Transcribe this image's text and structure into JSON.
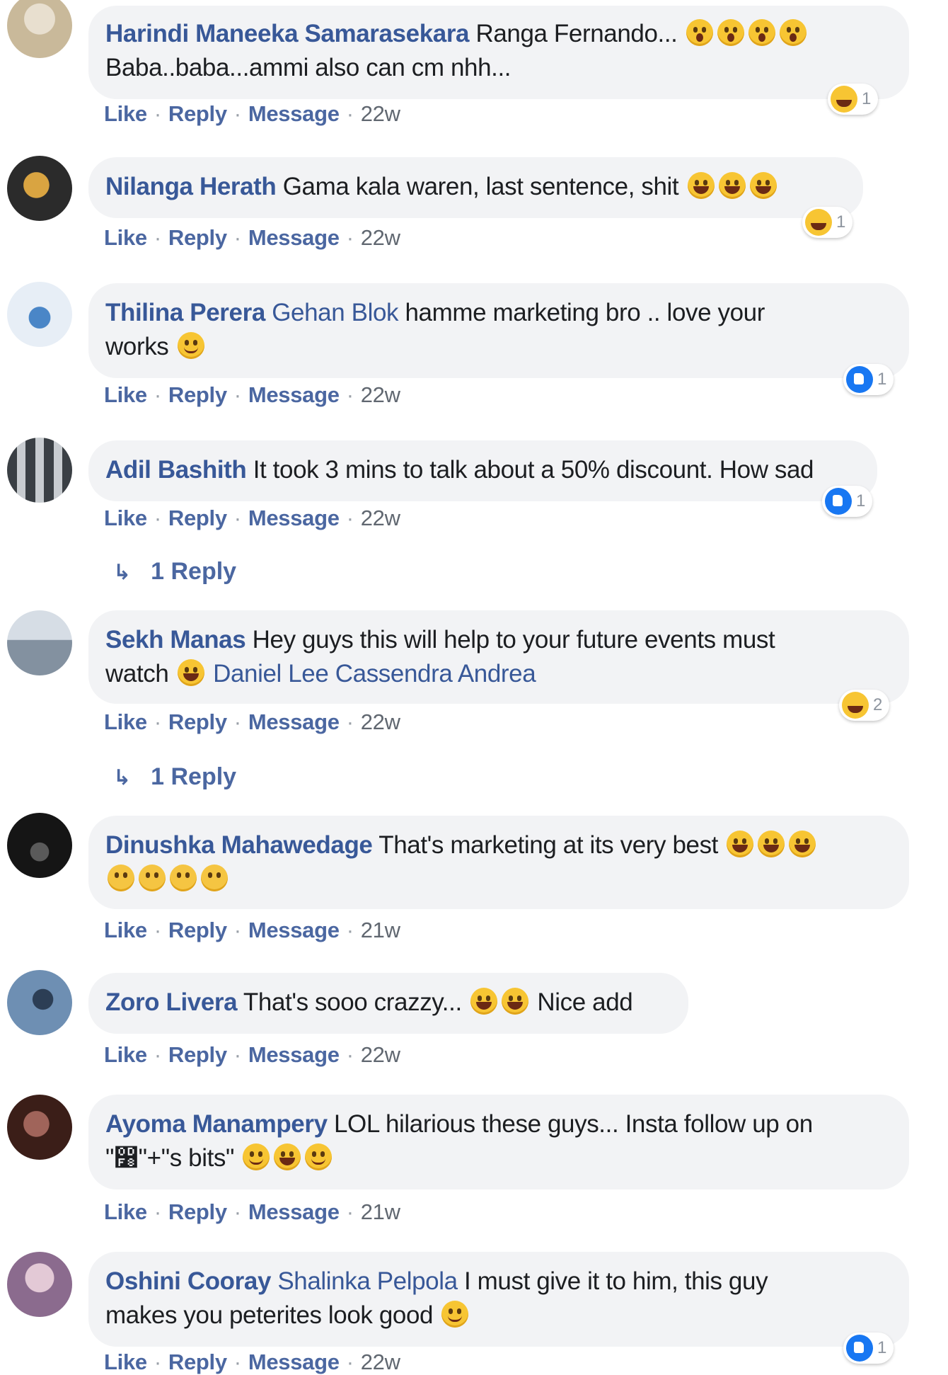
{
  "actions": {
    "like": "Like",
    "reply": "Reply",
    "message": "Message"
  },
  "comments": [
    {
      "author": "Harindi Maneeka Samarasekara",
      "tag": "",
      "text": "Ranga Fernando...",
      "line2": "Baba..baba...ammi also can cm nhh...",
      "time": "22w",
      "reaction": {
        "type": "haha",
        "count": "1"
      },
      "avatar_colors": [
        "#c9b99a",
        "#e8dfcf"
      ]
    },
    {
      "author": "Nilanga Herath",
      "text": "Gama kala waren, last sentence, shit",
      "time": "22w",
      "reaction": {
        "type": "haha",
        "count": "1"
      },
      "avatar_colors": [
        "#2b2b2b",
        "#d9a441"
      ]
    },
    {
      "author": "Thilina Perera",
      "tag": "Gehan Blok",
      "text": "hamme marketing bro .. love your",
      "line2": "works",
      "time": "22w",
      "reaction": {
        "type": "like",
        "count": "1"
      },
      "avatar_colors": [
        "#e7eef6",
        "#4a86c7"
      ]
    },
    {
      "author": "Adil Bashith",
      "text": "It took 3 mins to talk about a 50% discount. How sad",
      "time": "22w",
      "reaction": {
        "type": "like",
        "count": "1"
      },
      "replies": "1 Reply",
      "avatar_colors": [
        "#3a3f44",
        "#c8ccd0"
      ]
    },
    {
      "author": "Sekh Manas",
      "text": "Hey guys this will help to your future events must",
      "line2_pre": "watch",
      "tag2": "Daniel Lee Cassendra Andrea",
      "time": "22w",
      "reaction": {
        "type": "haha",
        "count": "2"
      },
      "replies": "1 Reply",
      "avatar_colors": [
        "#8391a0",
        "#d6dde5"
      ]
    },
    {
      "author": "Dinushka Mahawedage",
      "text": "That's marketing at its very best",
      "time": "21w",
      "avatar_colors": [
        "#151515",
        "#5a5a5a"
      ]
    },
    {
      "author": "Zoro Livera",
      "text": "That's sooo crazzy...",
      "text_post": "Nice add",
      "time": "22w",
      "avatar_colors": [
        "#6e8fb3",
        "#2c3e55"
      ]
    },
    {
      "author": "Ayoma Manampery",
      "text": "LOL hilarious these guys... Insta follow up on",
      "line2": "\"෸\"+\"s bits\"",
      "time": "21w",
      "avatar_colors": [
        "#3b1e18",
        "#a0645a"
      ]
    },
    {
      "author": "Oshini Cooray",
      "tag": "Shalinka Pelpola",
      "text": "I must give it to him, this guy",
      "line2": "makes you peterites look good",
      "time": "22w",
      "reaction": {
        "type": "like",
        "count": "1"
      },
      "avatar_colors": [
        "#8b6b8e",
        "#e3c9d6"
      ]
    }
  ]
}
